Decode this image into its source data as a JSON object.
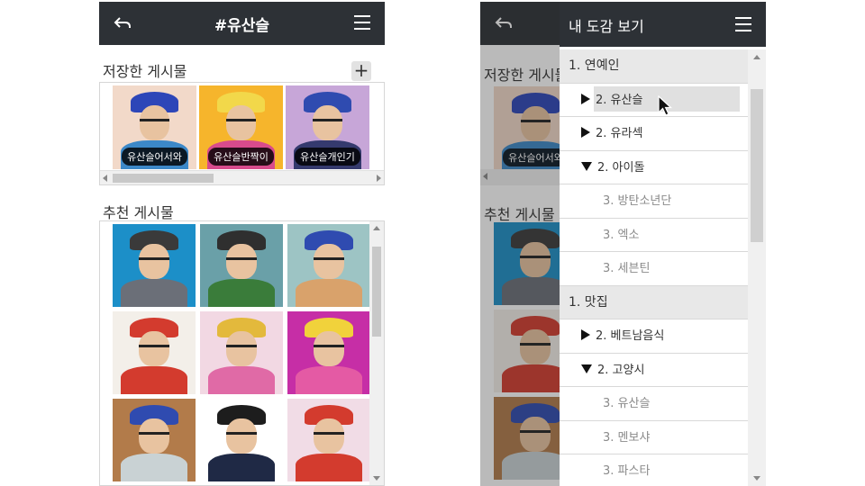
{
  "screenA": {
    "header": {
      "title": "#유산슬",
      "back_icon": "back-arrow-icon",
      "menu_icon": "hamburger-menu-icon"
    },
    "saved": {
      "title": "저장한 게시물",
      "add_label": "+",
      "items": [
        {
          "caption": "유산슬어서와",
          "bg": "#f2d9c9",
          "hat": "#2d46b8",
          "jacket": "#3c88c8"
        },
        {
          "caption": "유산슬반짝이",
          "bg": "#f6b52c",
          "hat": "#f2d84a",
          "jacket": "#d84b8c"
        },
        {
          "caption": "유산슬개인기",
          "bg": "#c7a6d8",
          "hat": "#2f4bb0",
          "jacket": "#353a6e"
        }
      ]
    },
    "recommended": {
      "title": "추천 게시물",
      "items": [
        {
          "bg": "#1c8fc8",
          "hat": "#3a3a3a",
          "jacket": "#6b6f78"
        },
        {
          "bg": "#6aa0a8",
          "hat": "#2f2f2f",
          "jacket": "#3a7c3a"
        },
        {
          "bg": "#9dc4c4",
          "hat": "#2f4bb0",
          "jacket": "#d9a26b"
        },
        {
          "bg": "#f3efe9",
          "hat": "#d33b2e",
          "jacket": "#d33b2e"
        },
        {
          "bg": "#f2d8e3",
          "hat": "#e3b93c",
          "jacket": "#e06aa6"
        },
        {
          "bg": "#c62ea6",
          "hat": "#f1d23b",
          "jacket": "#e45aa4"
        },
        {
          "bg": "#b27b4a",
          "hat": "#2f4bb0",
          "jacket": "#c9d2d4"
        },
        {
          "bg": "#ffffff",
          "hat": "#1d1d1d",
          "jacket": "#1f2945"
        },
        {
          "bg": "#f1dce6",
          "hat": "#d33b2e",
          "jacket": "#d33b2e"
        }
      ]
    }
  },
  "screenB": {
    "background": {
      "saved_title": "저장한 게시물",
      "saved_caption": "유산슬어서와",
      "recommended_title": "추천 게시물"
    },
    "drawer": {
      "title": "내 도감 보기",
      "menu_icon": "hamburger-menu-icon",
      "rows": [
        {
          "level": 1,
          "marker": "",
          "label": "1. 연예인"
        },
        {
          "level": 2,
          "marker": "right",
          "label": "2. 유산슬",
          "highlighted": true
        },
        {
          "level": 2,
          "marker": "right",
          "label": "2. 유라섹"
        },
        {
          "level": 2,
          "marker": "down",
          "label": "2. 아이돌"
        },
        {
          "level": 3,
          "marker": "",
          "label": "3. 방탄소년단"
        },
        {
          "level": 3,
          "marker": "",
          "label": "3. 엑소"
        },
        {
          "level": 3,
          "marker": "",
          "label": "3. 세븐틴"
        },
        {
          "level": 1,
          "marker": "",
          "label": "1. 맛집"
        },
        {
          "level": 2,
          "marker": "right",
          "label": "2. 베트남음식"
        },
        {
          "level": 2,
          "marker": "down",
          "label": "2. 고양시"
        },
        {
          "level": 3,
          "marker": "",
          "label": "3. 유산슬"
        },
        {
          "level": 3,
          "marker": "",
          "label": "3. 멘보샤"
        },
        {
          "level": 3,
          "marker": "",
          "label": "3. 파스타"
        }
      ]
    }
  }
}
